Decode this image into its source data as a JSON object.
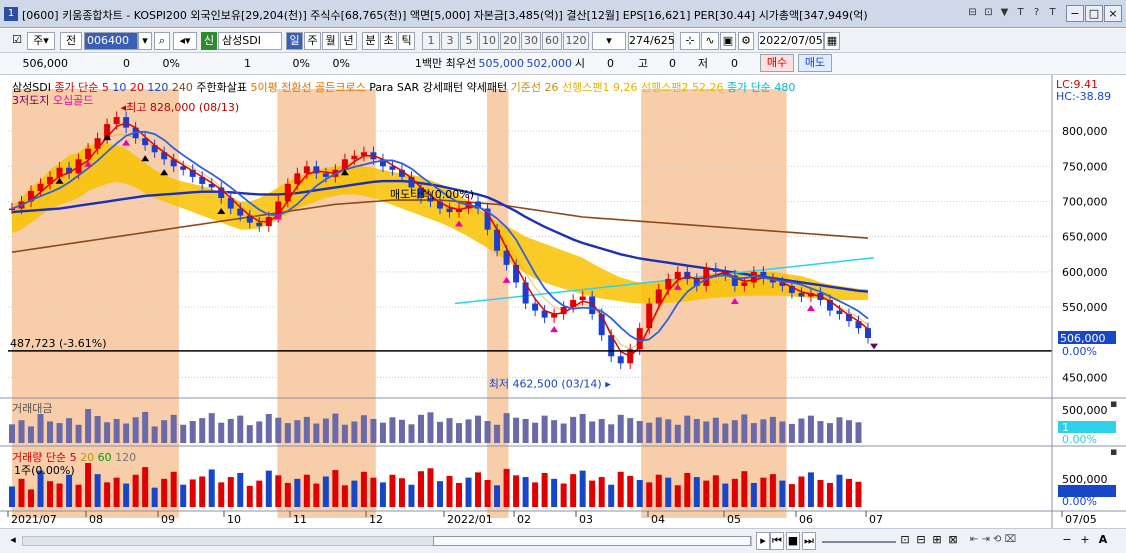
{
  "window": {
    "title": "[0600] 키움종합차트 - KOSPI200 외국인보유[29,204(천)] 주식수[68,765(천)] 액면[5,000] 자본금[3,485(억)] 결산[12월] EPS[16,621] PER[30.44] 시가총액[347,949(억)",
    "app_badge": "1",
    "title_icons": [
      "⊟",
      "⊡",
      "▼",
      "T",
      "?",
      "T"
    ],
    "controls": [
      "−",
      "□",
      "×"
    ]
  },
  "toolbar": {
    "period_button": "주",
    "prev_label": "전",
    "stock_code": "006400",
    "stock_name": "삼성SDI",
    "credit_badge": "신",
    "periods": [
      "일",
      "주",
      "월",
      "년",
      "분",
      "초",
      "틱"
    ],
    "selected_period": "일",
    "intervals": [
      "1",
      "3",
      "5",
      "10",
      "20",
      "30",
      "60",
      "120"
    ],
    "count_display": "274/625",
    "date_value": "2022/07/05"
  },
  "infobar": {
    "price": "506,000",
    "change": "0",
    "change_pct": "0%",
    "volume": "1",
    "volume_pct": "0%",
    "vol_pct2": "0%",
    "quote_label": "1백만 최우선",
    "ask": "505,000",
    "bid": "502,000",
    "ohlc_labels": [
      "시",
      "고",
      "저"
    ],
    "ohlc_values": [
      "0",
      "0",
      "0"
    ],
    "buy_label": "매수",
    "sell_label": "매도"
  },
  "legend": {
    "main": [
      {
        "text": "삼성SDI",
        "color": "#000000"
      },
      {
        "text": "종가 단순 5",
        "color": "#d40000"
      },
      {
        "text": "10",
        "color": "#1846c8"
      },
      {
        "text": "20",
        "color": "#d40000"
      },
      {
        "text": "120",
        "color": "#1846c8"
      },
      {
        "text": "240",
        "color": "#7a4b20"
      },
      {
        "text": "주한화살표",
        "color": "#000000"
      },
      {
        "text": "5이평 전환선 골든크로스",
        "color": "#e07000"
      },
      {
        "text": "Para SAR 강세패턴",
        "color": "#000000"
      },
      {
        "text": "약세패턴",
        "color": "#000000"
      },
      {
        "text": "기준선 26",
        "color": "#d08a00"
      },
      {
        "text": "선행스팬1 9,26",
        "color": "#e3b400"
      },
      {
        "text": "선행스팬2 52,26",
        "color": "#e3b400"
      },
      {
        "text": "종가 단순 480",
        "color": "#00b8d8"
      }
    ],
    "line2": [
      {
        "text": "3저도지",
        "color": "#6a0066"
      },
      {
        "text": "오십골드",
        "color": "#ee00aa"
      }
    ],
    "lc": "LC:9.41",
    "hc": "HC:-38.89",
    "volume_panel_title": "거래대금",
    "qty_panel": [
      {
        "text": "거래량",
        "color": "#d40000"
      },
      {
        "text": "단순 5",
        "color": "#d40000"
      },
      {
        "text": "20",
        "color": "#b8a000"
      },
      {
        "text": "60",
        "color": "#00a000"
      },
      {
        "text": "120",
        "color": "#777777"
      }
    ],
    "qty_panel_line2": "1주(0.00%)"
  },
  "chart_data": {
    "type": "candlestick",
    "y_ticks": [
      "800,000",
      "750,000",
      "700,000",
      "650,000",
      "600,000",
      "550,000",
      "450,000"
    ],
    "ylim": [
      425000,
      840000
    ],
    "x_ticks": [
      "2021/07",
      "08",
      "09",
      "10",
      "11",
      "12",
      "2022/01",
      "02",
      "03",
      "04",
      "05",
      "06",
      "07",
      "07/05"
    ],
    "current_price_label": "506,000",
    "current_pct_label": "0.00%",
    "ref_line_label": "487,723 (-3.61%)",
    "ref_line_value": 487723,
    "high_label": "최고 828,000 (08/13)",
    "low_label": "최저 462,500 (03/14)",
    "center_label": "매도타락(0.00%)",
    "close_series": [
      690,
      700,
      715,
      725,
      735,
      748,
      740,
      760,
      775,
      790,
      810,
      820,
      805,
      790,
      780,
      770,
      760,
      750,
      745,
      735,
      725,
      720,
      705,
      690,
      680,
      670,
      665,
      678,
      700,
      725,
      740,
      750,
      740,
      735,
      745,
      760,
      765,
      770,
      760,
      750,
      745,
      735,
      720,
      705,
      700,
      690,
      685,
      690,
      700,
      690,
      660,
      630,
      610,
      585,
      555,
      545,
      535,
      540,
      550,
      560,
      565,
      540,
      510,
      480,
      470,
      490,
      520,
      555,
      575,
      590,
      600,
      590,
      580,
      605,
      600,
      595,
      580,
      585,
      600,
      590,
      585,
      580,
      570,
      565,
      570,
      560,
      545,
      540,
      530,
      520,
      506
    ],
    "ma20_series": [
      695,
      700,
      705,
      712,
      722,
      730,
      740,
      750,
      760,
      775,
      790,
      795,
      795,
      790,
      785,
      778,
      770,
      762,
      755,
      748,
      740,
      732,
      720,
      708,
      695,
      683,
      675,
      675,
      683,
      700,
      718,
      735,
      742,
      742,
      745,
      752,
      758,
      762,
      762,
      758,
      752,
      745,
      733,
      720,
      710,
      700,
      693,
      690,
      692,
      690,
      678,
      660,
      640,
      620,
      598,
      578,
      562,
      550,
      545,
      548,
      555,
      550,
      535,
      515,
      497,
      490,
      500,
      520,
      545,
      570,
      585,
      590,
      590,
      595,
      597,
      597,
      592,
      590,
      592,
      592,
      590,
      585,
      578,
      572,
      570,
      566,
      558,
      550,
      543,
      535,
      525
    ],
    "ma120_series": [
      685,
      686,
      687,
      688,
      689,
      690,
      692,
      694,
      696,
      698,
      700,
      702,
      704,
      706,
      708,
      709,
      710,
      711,
      712,
      713,
      714,
      714,
      714,
      713,
      712,
      711,
      710,
      710,
      710,
      711,
      712,
      714,
      716,
      718,
      720,
      722,
      724,
      726,
      728,
      729,
      729,
      729,
      728,
      726,
      724,
      722,
      719,
      716,
      713,
      710,
      706,
      700,
      693,
      686,
      678,
      671,
      664,
      658,
      652,
      646,
      641,
      637,
      633,
      629,
      625,
      622,
      619,
      617,
      615,
      613,
      611,
      609,
      607,
      605,
      603,
      601,
      599,
      597,
      595,
      593,
      591,
      589,
      587,
      585,
      583,
      581,
      579,
      577,
      575,
      573,
      572
    ],
    "ma240_series": [
      628,
      630,
      632,
      634,
      636,
      638,
      640,
      642,
      644,
      646,
      648,
      650,
      652,
      654,
      656,
      658,
      660,
      662,
      664,
      666,
      668,
      670,
      672,
      674,
      676,
      678,
      680,
      682,
      684,
      686,
      688,
      690,
      692,
      694,
      696,
      697,
      698,
      699,
      700,
      701,
      702,
      702,
      702,
      702,
      702,
      702,
      701,
      700,
      699,
      698,
      697,
      696,
      694,
      692,
      690,
      688,
      686,
      684,
      682,
      680,
      678,
      677,
      676,
      675,
      674,
      673,
      672,
      671,
      670,
      669,
      668,
      667,
      666,
      665,
      664,
      663,
      662,
      661,
      660,
      659,
      658,
      657,
      656,
      655,
      654,
      653,
      652,
      651,
      650,
      649,
      648
    ],
    "ichimoku_upper": [
      690,
      705,
      720,
      730,
      745,
      755,
      765,
      770,
      780,
      782,
      782,
      780,
      775,
      765,
      755,
      745,
      738,
      732,
      728,
      725,
      722,
      718,
      712,
      705,
      700,
      700,
      705,
      712,
      720,
      728,
      735,
      740,
      745,
      748,
      750,
      752,
      752,
      750,
      748,
      745,
      742,
      740,
      738,
      735,
      730,
      725,
      718,
      710,
      700,
      690,
      680,
      672,
      665,
      658,
      650,
      645,
      640,
      635,
      630,
      625,
      620,
      612,
      605,
      598,
      592,
      588,
      585,
      585,
      586,
      588,
      590,
      592,
      594,
      596,
      598,
      600,
      600,
      600,
      600,
      600,
      600,
      598,
      596,
      594,
      590,
      585,
      582,
      580,
      578,
      576,
      575
    ],
    "ichimoku_lower": [
      655,
      660,
      670,
      680,
      690,
      695,
      700,
      705,
      715,
      720,
      725,
      728,
      725,
      720,
      712,
      705,
      700,
      695,
      690,
      685,
      680,
      675,
      670,
      665,
      660,
      660,
      662,
      668,
      675,
      682,
      690,
      695,
      700,
      705,
      708,
      710,
      710,
      708,
      705,
      700,
      695,
      690,
      685,
      680,
      675,
      670,
      664,
      657,
      650,
      642,
      634,
      625,
      616,
      607,
      598,
      590,
      585,
      580,
      576,
      572,
      568,
      565,
      562,
      560,
      558,
      556,
      555,
      555,
      555,
      556,
      557,
      558,
      560,
      562,
      563,
      564,
      565,
      566,
      566,
      566,
      566,
      566,
      565,
      564,
      563,
      562,
      561,
      560,
      560,
      560,
      560
    ],
    "volume_series": [
      45,
      55,
      40,
      70,
      52,
      48,
      60,
      44,
      82,
      65,
      50,
      58,
      47,
      62,
      75,
      40,
      55,
      68,
      44,
      53,
      60,
      72,
      49,
      58,
      66,
      43,
      52,
      70,
      61,
      48,
      55,
      63,
      47,
      59,
      71,
      44,
      52,
      67,
      58,
      49,
      62,
      56,
      45,
      68,
      74,
      51,
      60,
      48,
      57,
      66,
      53,
      44,
      72,
      61,
      58,
      49,
      66,
      55,
      47,
      63,
      70,
      52,
      58,
      45,
      68,
      60,
      53,
      49,
      62,
      57,
      44,
      66,
      58,
      52,
      61,
      47,
      55,
      69,
      48,
      57,
      63,
      52,
      46,
      59,
      66,
      53,
      48,
      62,
      55,
      50
    ],
    "qty_series": [
      35,
      48,
      30,
      62,
      44,
      40,
      55,
      38,
      75,
      56,
      42,
      50,
      40,
      55,
      68,
      33,
      48,
      60,
      38,
      47,
      52,
      64,
      42,
      51,
      58,
      36,
      45,
      62,
      54,
      41,
      48,
      55,
      40,
      52,
      63,
      37,
      45,
      60,
      50,
      42,
      55,
      49,
      38,
      61,
      66,
      44,
      53,
      41,
      50,
      59,
      46,
      37,
      65,
      54,
      51,
      42,
      58,
      48,
      40,
      56,
      62,
      45,
      51,
      38,
      60,
      53,
      46,
      42,
      55,
      50,
      37,
      58,
      51,
      45,
      54,
      40,
      48,
      61,
      41,
      50,
      56,
      45,
      39,
      52,
      59,
      46,
      41,
      55,
      48,
      43
    ],
    "vol_panel_ticks": [
      "500,000"
    ],
    "vol_panel_pct": "0.00%",
    "vol_panel_current": "1",
    "qty_panel_ticks": [
      "500,000"
    ],
    "qty_panel_pct": "0.00%",
    "trendline_label": "종가 단순 480"
  },
  "colors": {
    "up": "#e00000",
    "down": "#1a3fd0",
    "highlight_band": "#f7c59b",
    "ichimoku_cloud": "#f9c200",
    "accent": "#3a5fb5"
  },
  "scrollbar": {
    "zoom_icons": [
      "⊡",
      "⊟",
      "⊞",
      "⊠",
      "−",
      "+",
      "A"
    ]
  }
}
